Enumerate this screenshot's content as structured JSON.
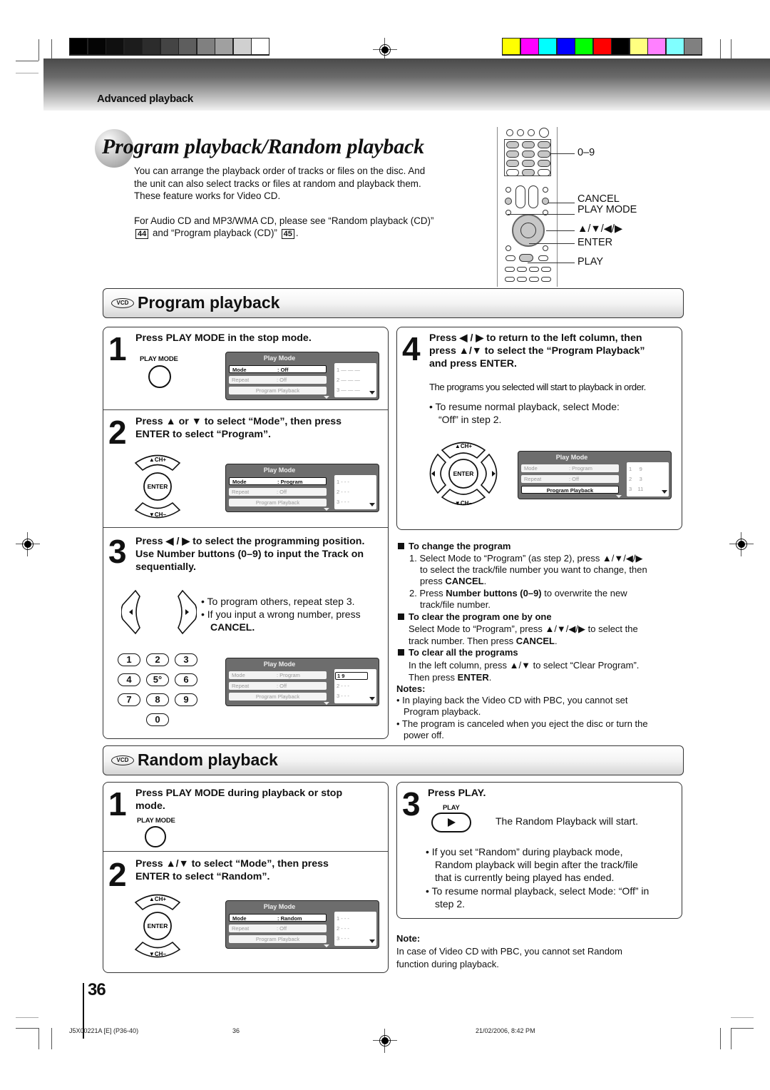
{
  "header": {
    "section_label": "Advanced playback",
    "grayscale_swatches": [
      "#000000",
      "#050505",
      "#101010",
      "#1c1c1c",
      "#2c2c2c",
      "#444444",
      "#5e5e5e",
      "#808080",
      "#a0a0a0",
      "#d0d0d0",
      "#ffffff"
    ],
    "color_swatches": [
      "#ffff00",
      "#ff00ff",
      "#00ffff",
      "#0000ff",
      "#00ff00",
      "#ff0000",
      "#000000",
      "#ffff80",
      "#ff80ff",
      "#80ffff",
      "#808080"
    ]
  },
  "title": "Program playback/Random playback",
  "intro": {
    "paragraph1": "You can arrange the playback order of tracks or files on the disc. And the unit can also select tracks or files at random and playback them. These feature works for Video CD.",
    "paragraph2_pre": "For Audio CD and MP3/WMA CD, please see “Random playback (CD)”",
    "ref1": "44",
    "paragraph2_mid": "and “Program playback (CD)”",
    "ref2": "45",
    "paragraph2_post": "."
  },
  "remote": {
    "labels": {
      "numbers": "0–9",
      "cancel": "CANCEL",
      "play_mode": "PLAY MODE",
      "arrows": "▲/▼/◀/▶",
      "enter": "ENTER",
      "play": "PLAY"
    }
  },
  "program": {
    "badge": "VCD",
    "title": "Program playback",
    "step1": {
      "num": "1",
      "text": "Press PLAY MODE in the stop mode.",
      "button_label": "PLAY MODE",
      "osd": {
        "title": "Play Mode",
        "mode_key": "Mode",
        "mode_val": ": Off",
        "repeat_key": "Repeat",
        "repeat_val": ": Off",
        "action": "Program Playback",
        "list": [
          "1  — — —",
          "2  — — —",
          "3  — — —"
        ]
      }
    },
    "step2": {
      "num": "2",
      "text_line1": "Press ▲ or ▼ to select “Mode”, then press",
      "text_line2": "ENTER to select “Program”.",
      "ch_up": "▲CH+",
      "enter": "ENTER",
      "ch_down": "▼CH−",
      "osd": {
        "title": "Play Mode",
        "mode_key": "Mode",
        "mode_val": ": Program",
        "repeat_key": "Repeat",
        "repeat_val": ": Off",
        "action": "Program Playback",
        "list": [
          "1  - - -",
          "2  - - -",
          "3  - - -"
        ]
      }
    },
    "step3": {
      "num": "3",
      "text_line1": "Press ◀ / ▶ to select the programming position.",
      "text_line2": "Use Number buttons (0–9) to input the Track on",
      "text_line3": "sequentially.",
      "bullet1": "•  To program others, repeat step 3.",
      "bullet2": "•  If you input a wrong number, press",
      "bullet2_bold": "CANCEL.",
      "keys": [
        "1",
        "2",
        "3",
        "4",
        "5°",
        "6",
        "7",
        "8",
        "9",
        "0"
      ],
      "osd": {
        "title": "Play Mode",
        "mode_key": "Mode",
        "mode_val": ": Program",
        "repeat_key": "Repeat",
        "repeat_val": ": Off",
        "action": "Program Playback",
        "list_sel": "1       9",
        "list": [
          "2  - - -",
          "3  - - -"
        ]
      }
    },
    "step4": {
      "num": "4",
      "text_line1": "Press ◀ / ▶ to return to the left column, then",
      "text_line2": "press ▲/▼ to select the “Program Playback”",
      "text_line3": "and press ENTER.",
      "body": "The programs you selected will start to playback in order.",
      "bullet1": "•  To resume normal playback, select Mode:",
      "bullet1_cont": "“Off” in step 2.",
      "ch_up": "▲CH+",
      "enter": "ENTER",
      "ch_down": "▼CH−",
      "osd": {
        "title": "Play Mode",
        "mode_key": "Mode",
        "mode_val": ": Program",
        "repeat_key": "Repeat",
        "repeat_val": ": Off",
        "action": "Program Playback",
        "list": [
          "1     9",
          "2     3",
          "3    11"
        ]
      }
    },
    "tips": {
      "change_title": "To change the program",
      "change_1a": "1. Select Mode to “Program” (as step 2), press ▲/▼/◀/▶",
      "change_1b": "to select the track/file number you want to change, then",
      "change_1c_pre": "press ",
      "change_1c_bold": "CANCEL",
      "change_1c_post": ".",
      "change_2a_pre": "2. Press ",
      "change_2a_bold": "Number buttons (0–9)",
      "change_2a_post": " to overwrite the new",
      "change_2b": "track/file number.",
      "clear_one_title": "To clear the program one by one",
      "clear_one_a": "Select Mode to “Program”, press ▲/▼/◀/▶ to select the",
      "clear_one_b_pre": "track number. Then press ",
      "clear_one_b_bold": "CANCEL",
      "clear_one_b_post": ".",
      "clear_all_title": "To clear all the programs",
      "clear_all_a": "In the left column, press ▲/▼ to select “Clear Program”.",
      "clear_all_b_pre": "Then press ",
      "clear_all_b_bold": "ENTER",
      "clear_all_b_post": ".",
      "notes_title": "Notes:",
      "note1a": "• In playing back the Video CD with PBC, you cannot set",
      "note1b": "Program playback.",
      "note2a": "• The program is canceled when you eject the disc or turn the",
      "note2b": "power off."
    }
  },
  "random": {
    "badge": "VCD",
    "title": "Random playback",
    "step1": {
      "num": "1",
      "text_line1": "Press PLAY MODE during playback or stop",
      "text_line2": "mode.",
      "button_label": "PLAY MODE"
    },
    "step2": {
      "num": "2",
      "text_line1": "Press ▲/▼ to select “Mode”, then press",
      "text_line2": "ENTER to select “Random”.",
      "ch_up": "▲CH+",
      "enter": "ENTER",
      "ch_down": "▼CH−",
      "osd": {
        "title": "Play Mode",
        "mode_key": "Mode",
        "mode_val": ": Random",
        "repeat_key": "Repeat",
        "repeat_val": ": Off",
        "action": "Program Playback",
        "list": [
          "1  - - -",
          "2  - - -",
          "3  - - -"
        ]
      }
    },
    "step3": {
      "num": "3",
      "text": "Press PLAY.",
      "button_label": "PLAY",
      "result": "The Random Playback will start.",
      "bullet1a": "•  If you set “Random” during playback mode,",
      "bullet1b": "Random playback will begin after the track/file",
      "bullet1c": "that is currently being played has ended.",
      "bullet2a": "•  To resume normal playback, select Mode: “Off” in",
      "bullet2b": "step 2."
    },
    "note_title": "Note:",
    "note_a": "In case of Video CD with PBC, you cannot set Random",
    "note_b": "function during playback."
  },
  "page_number": "36",
  "footer": {
    "doc_code": "J5X00221A [E] (P36-40)",
    "page": "36",
    "date": "21/02/2006, 8:42 PM"
  }
}
